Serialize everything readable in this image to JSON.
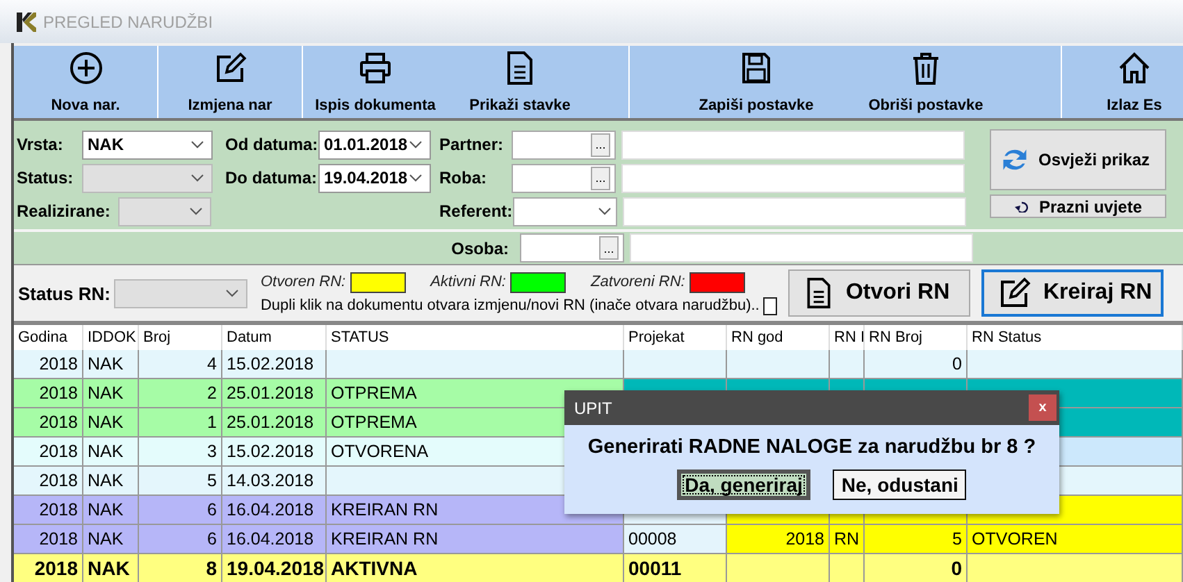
{
  "window": {
    "title": "PREGLED NARUDŽBI"
  },
  "toolbar": [
    {
      "label": "Nova nar.",
      "kind": "plus"
    },
    {
      "label": "Izmjena nar",
      "kind": "edit"
    },
    {
      "label": "Ispis dokumenta",
      "kind": "print"
    },
    {
      "label": "Prikaži stavke",
      "kind": "doc"
    },
    {
      "label": "Zapiši postavke",
      "kind": "save"
    },
    {
      "label": "Obriši postavke",
      "kind": "trash"
    },
    {
      "label": "Izlaz Es",
      "kind": "home"
    }
  ],
  "filters": {
    "vrsta": {
      "label": "Vrsta:",
      "value": "NAK"
    },
    "status": {
      "label": "Status:",
      "disabled": true
    },
    "realizirane": {
      "label": "Realizirane:",
      "disabled": true
    },
    "od_datuma": {
      "label": "Od datuma:",
      "value": "01.01.2018"
    },
    "do_datuma": {
      "label": "Do datuma:",
      "value": "19.04.2018"
    },
    "partner": {
      "label": "Partner:",
      "browse": "..."
    },
    "roba": {
      "label": "Roba:",
      "browse": "..."
    },
    "referent": {
      "label": "Referent:"
    },
    "osoba": {
      "label": "Osoba:",
      "browse": "..."
    },
    "refresh_button": "Osvježi prikaz",
    "clear_button": "Prazni uvjete"
  },
  "status_rn": {
    "label": "Status RN:",
    "disabled": true,
    "legend": [
      {
        "label": "Otvoren RN:",
        "color": "#ffff00"
      },
      {
        "label": "Aktivni RN:",
        "color": "#00ff00"
      },
      {
        "label": "Zatvoreni RN:",
        "color": "#ff0000"
      }
    ],
    "double_click_note": "Dupli klik na dokumentu otvara izmjenu/novi RN (inače otvara narudžbu)..",
    "double_click_checked": false,
    "open_button": "Otvori RN",
    "create_button": "Kreiraj RN"
  },
  "table": {
    "columns": [
      "Godina",
      "IDDOK",
      "Broj",
      "Datum",
      "STATUS",
      "Projekat",
      "RN god",
      "RN I",
      "RN Broj",
      "RN Status"
    ],
    "rows": [
      {
        "kind": "none",
        "selected": false,
        "cells": [
          "2018",
          "NAK",
          "4",
          "15.02.2018",
          null,
          null,
          null,
          null,
          "0",
          null
        ]
      },
      {
        "kind": "delivery",
        "selected": false,
        "cells": [
          "2018",
          "NAK",
          "2",
          "25.01.2018",
          "OTPREMA",
          null,
          null,
          null,
          null,
          null
        ]
      },
      {
        "kind": "delivery",
        "selected": false,
        "cells": [
          "2018",
          "NAK",
          "1",
          "25.01.2018",
          "OTPREMA",
          null,
          null,
          null,
          null,
          null
        ]
      },
      {
        "kind": "open",
        "selected": false,
        "cells": [
          "2018",
          "NAK",
          "3",
          "15.02.2018",
          "OTVORENA",
          null,
          null,
          null,
          null,
          null
        ]
      },
      {
        "kind": "none",
        "selected": false,
        "cells": [
          "2018",
          "NAK",
          "5",
          "14.03.2018",
          null,
          null,
          null,
          null,
          null,
          null
        ]
      },
      {
        "kind": "created",
        "selected": false,
        "cells": [
          "2018",
          "NAK",
          "6",
          "16.04.2018",
          "KREIRAN RN",
          null,
          null,
          null,
          null,
          null
        ]
      },
      {
        "kind": "created",
        "selected": false,
        "cells": [
          "2018",
          "NAK",
          "6",
          "16.04.2018",
          "KREIRAN RN",
          "00008",
          "2018",
          "RN",
          "5",
          "OTVOREN"
        ]
      },
      {
        "kind": "active",
        "selected": true,
        "cells": [
          "2018",
          "NAK",
          "8",
          "19.04.2018",
          "AKTIVNA",
          "00011",
          null,
          null,
          "0",
          null
        ]
      }
    ]
  },
  "dialog": {
    "title": "UPIT",
    "close": "x",
    "message": "Generirati RADNE NALOGE za narudžbu br 8 ?",
    "buttons": [
      {
        "label": "Da, generiraj",
        "selected": true
      },
      {
        "label": "Ne, odustani",
        "selected": false
      }
    ]
  }
}
